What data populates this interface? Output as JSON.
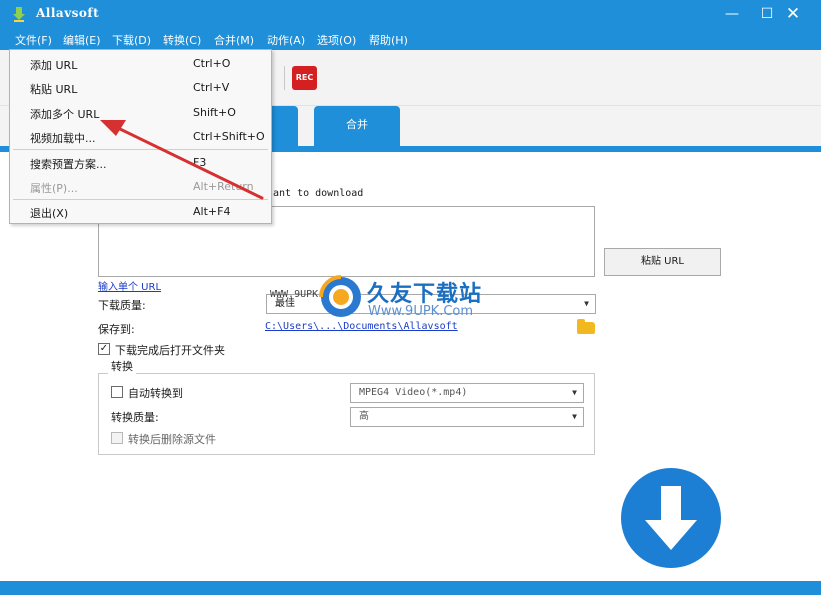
{
  "window": {
    "title": "Allavsoft",
    "min_glyph": "—",
    "max_glyph": "☐",
    "close_glyph": "✕"
  },
  "menubar": {
    "items": [
      "文件(F)",
      "编辑(E)",
      "下载(D)",
      "转换(C)",
      "合并(M)",
      "动作(A)",
      "选项(O)",
      "帮助(H)"
    ]
  },
  "toolbar": {
    "rec_label": "REC"
  },
  "tabs": {
    "download_label": "",
    "merge_label": "合并"
  },
  "file_menu": {
    "items": [
      {
        "label": "添加 URL",
        "shortcut": "Ctrl+O",
        "enabled": true
      },
      {
        "label": "粘贴 URL",
        "shortcut": "Ctrl+V",
        "enabled": true
      },
      {
        "label": "添加多个 URL",
        "shortcut": "Shift+O",
        "enabled": true
      },
      {
        "label": "视频加载中...",
        "shortcut": "Ctrl+Shift+O",
        "enabled": true
      },
      {
        "label": "搜索预置方案...",
        "shortcut": "F3",
        "enabled": true
      },
      {
        "label": "属性(P)...",
        "shortcut": "Alt+Return",
        "enabled": false
      },
      {
        "label": "退出(X)",
        "shortcut": "Alt+F4",
        "enabled": true
      }
    ]
  },
  "download": {
    "url_hint": "ant to download",
    "url_value": "",
    "paste_button": "粘贴 URL",
    "single_url_link": "输入单个 URL",
    "quality_label": "下载质量:",
    "quality_value": "最佳",
    "save_to_label": "保存到:",
    "save_path": "C:\\Users\\...\\Documents\\Allavsoft",
    "open_folder_label": "下载完成后打开文件夹",
    "open_folder_checked": true
  },
  "convert": {
    "group_label": "转换",
    "auto_convert_label": "自动转换到",
    "auto_convert_checked": false,
    "format_value": "MPEG4 Video(*.mp4)",
    "quality_label": "转换质量:",
    "quality_value": "高",
    "delete_source_label": "转换后删除源文件",
    "delete_source_checked": false
  },
  "watermark": {
    "url": "WWW.9UPK.COM",
    "name": "久友下载站",
    "sub": "Www.9UPK.Com"
  },
  "colors": {
    "accent": "#1e8fd8",
    "download_button": "#1c7fd4",
    "rec": "#d42020",
    "annotation_arrow": "#d63030"
  }
}
